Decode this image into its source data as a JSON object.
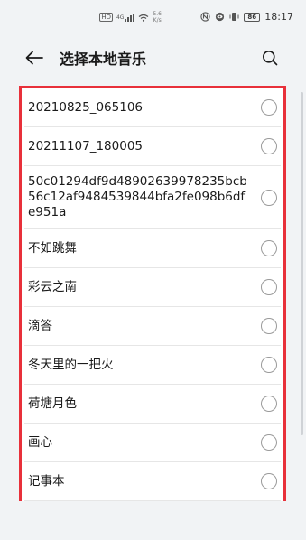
{
  "status_bar": {
    "sim_badge": "HD",
    "signal_badge": "4G",
    "net_speed_value": "5.6",
    "net_speed_unit": "K/s",
    "battery": "86",
    "time": "18:17"
  },
  "header": {
    "title": "选择本地音乐"
  },
  "music_list": {
    "items": [
      {
        "label": "20210825_065106",
        "selected": false
      },
      {
        "label": "20211107_180005",
        "selected": false
      },
      {
        "label": "50c01294df9d48902639978235bcb56c12af9484539844bfa2fe098b6dfe951a",
        "selected": false
      },
      {
        "label": "不如跳舞",
        "selected": false
      },
      {
        "label": "彩云之南",
        "selected": false
      },
      {
        "label": "滴答",
        "selected": false
      },
      {
        "label": "冬天里的一把火",
        "selected": false
      },
      {
        "label": "荷塘月色",
        "selected": false
      },
      {
        "label": "画心",
        "selected": false
      },
      {
        "label": "记事本",
        "selected": false
      },
      {
        "label": "",
        "selected": false
      }
    ]
  },
  "colors": {
    "highlight_border": "#e8303a",
    "background": "#f1f3f5",
    "radio_border": "#9a9a9a"
  }
}
